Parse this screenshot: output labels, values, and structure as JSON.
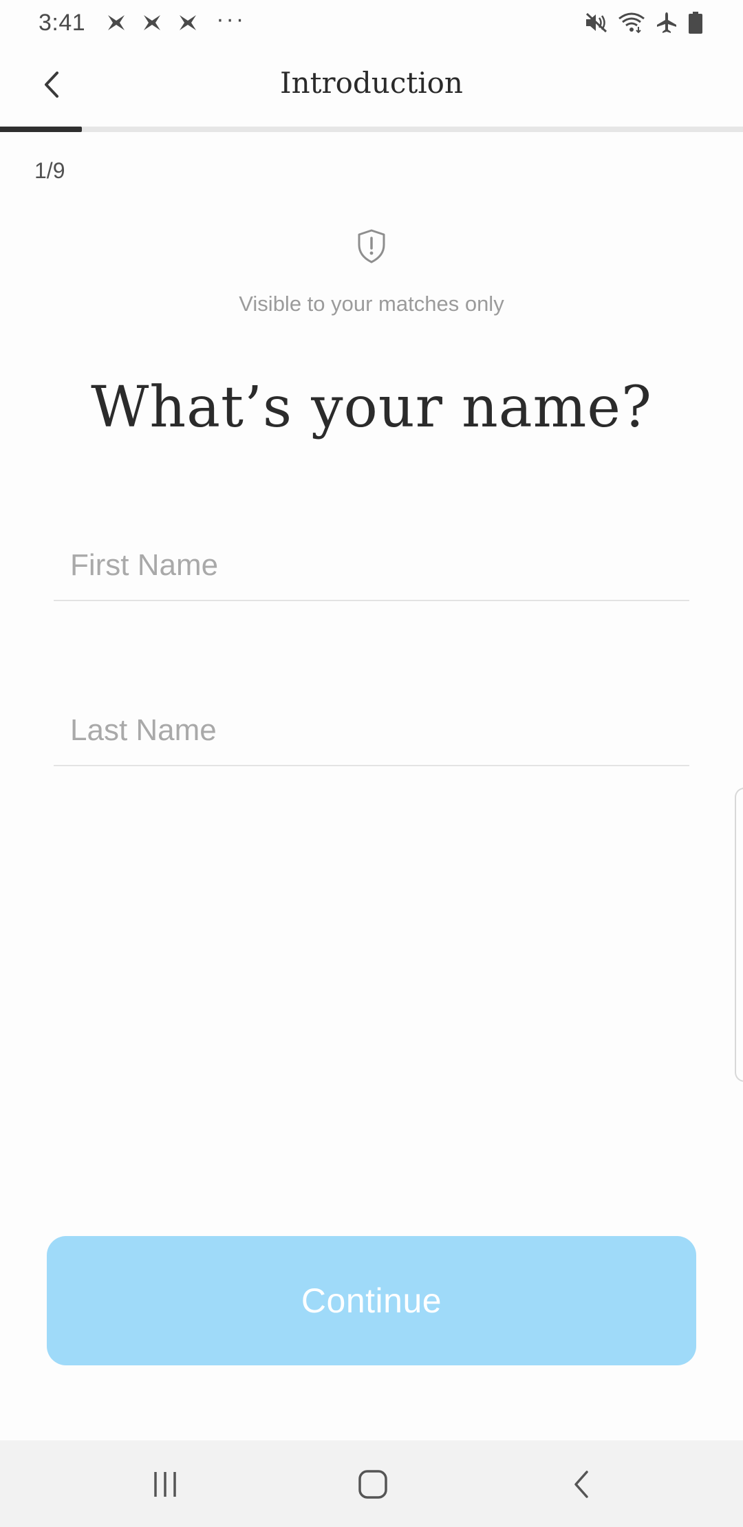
{
  "status_bar": {
    "time": "3:41",
    "notification_icons": [
      "app-notification-icon",
      "app-notification-icon",
      "app-notification-icon"
    ],
    "overflow": "···",
    "right_icons": [
      "mute-icon",
      "wifi-icon",
      "airplane-mode-icon",
      "battery-icon"
    ]
  },
  "header": {
    "title": "Introduction",
    "back_icon": "chevron-left-icon"
  },
  "progress": {
    "current_step": 1,
    "total_steps": 9,
    "fraction": 0.11,
    "fill_color": "#2f2f2f",
    "track_color": "#e6e6e6"
  },
  "step_label": "1/9",
  "privacy": {
    "icon": "shield-alert-icon",
    "note": "Visible to your matches only"
  },
  "question": "What’s your name?",
  "form": {
    "first_name": {
      "value": "",
      "placeholder": "First Name"
    },
    "last_name": {
      "value": "",
      "placeholder": "Last Name"
    }
  },
  "continue_button": {
    "label": "Continue",
    "color": "#9fdaf9",
    "enabled": false
  },
  "nav_bar": {
    "buttons": [
      "recent-apps-icon",
      "home-icon",
      "back-icon"
    ]
  }
}
